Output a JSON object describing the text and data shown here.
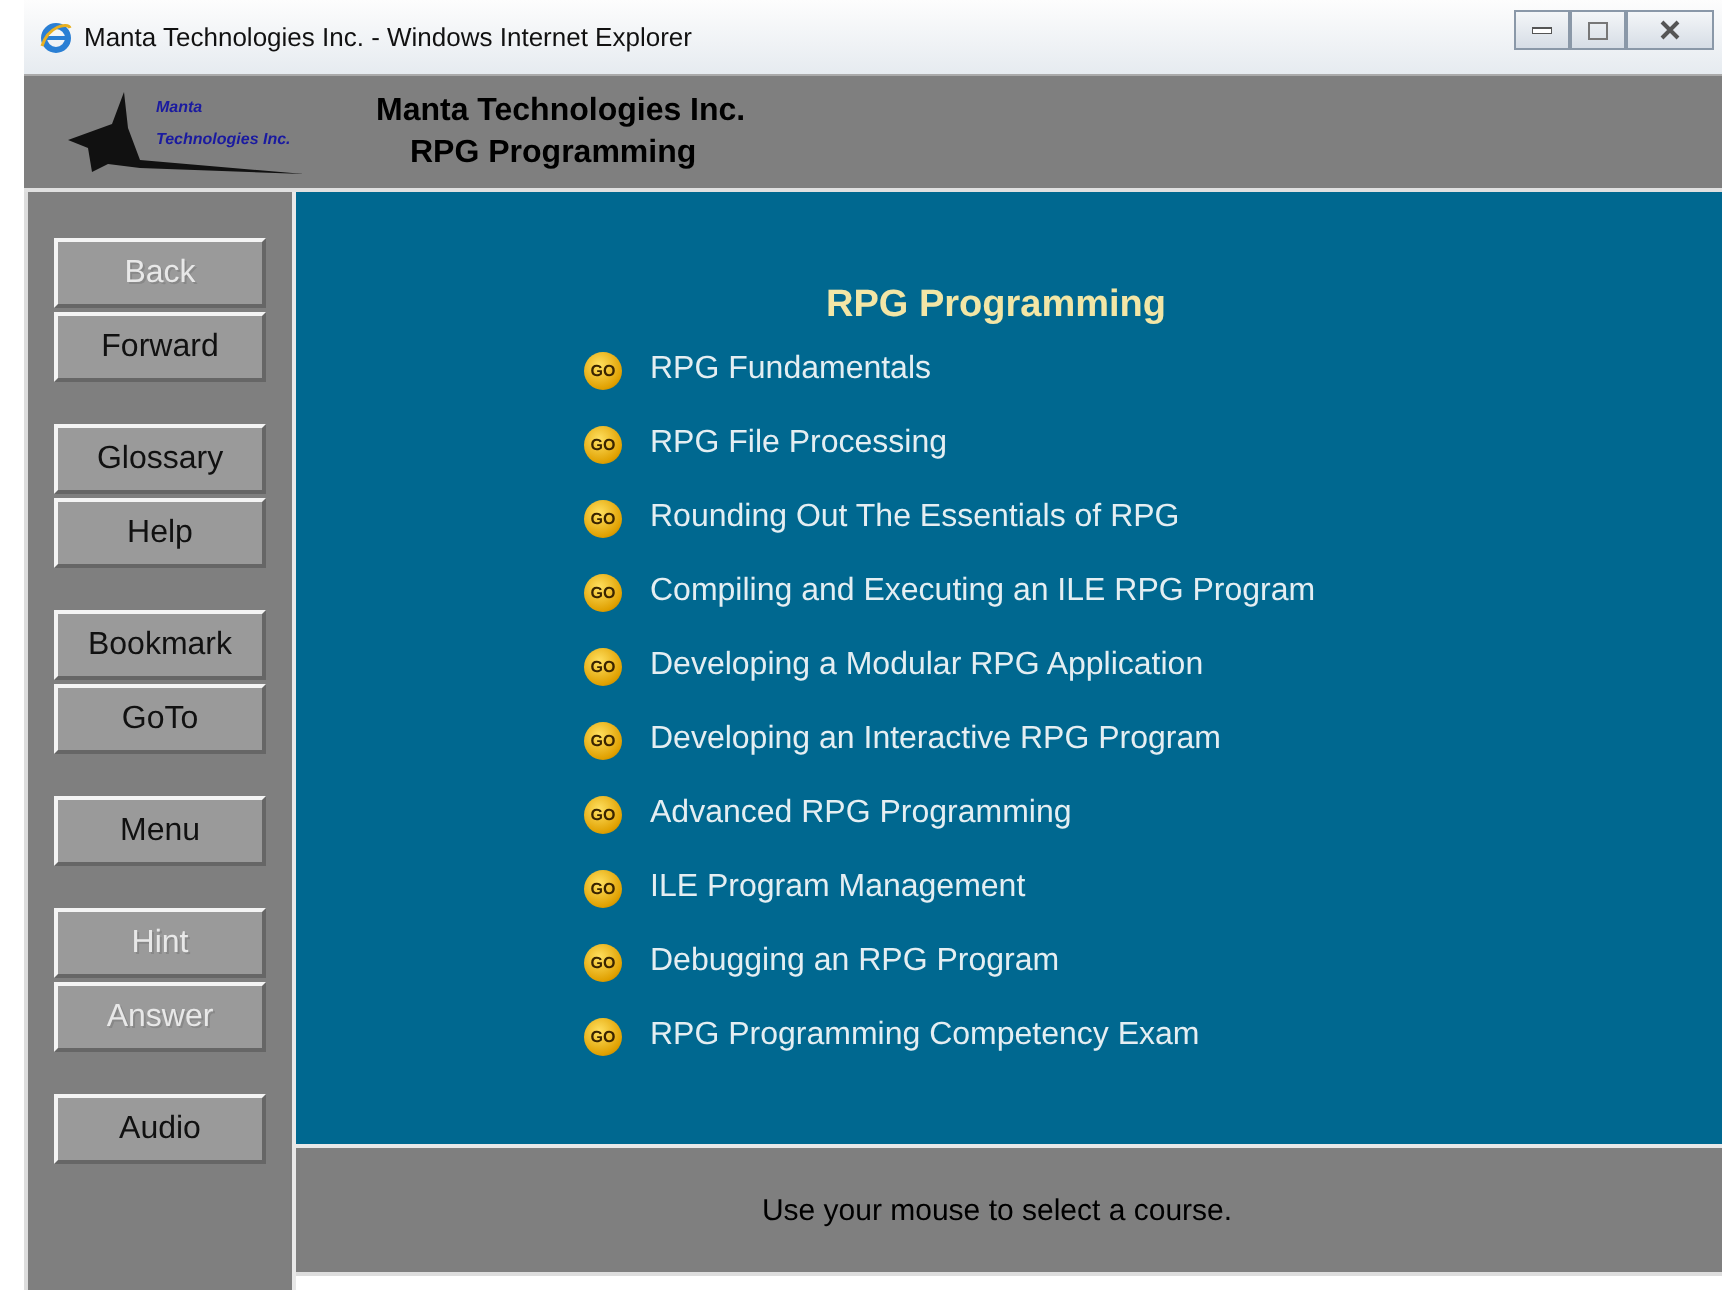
{
  "window": {
    "title": "Manta Technologies Inc. - Windows Internet Explorer"
  },
  "header": {
    "logo_lines": [
      "Manta",
      "Technologies Inc."
    ],
    "title_lines": [
      "Manta Technologies Inc.",
      "RPG Programming"
    ]
  },
  "sidebar": {
    "groups": [
      [
        {
          "label": "Back",
          "disabled": true
        },
        {
          "label": "Forward",
          "disabled": false
        }
      ],
      [
        {
          "label": "Glossary",
          "disabled": false
        },
        {
          "label": "Help",
          "disabled": false
        }
      ],
      [
        {
          "label": "Bookmark",
          "disabled": false
        },
        {
          "label": "GoTo",
          "disabled": false
        }
      ],
      [
        {
          "label": "Menu",
          "disabled": false
        }
      ],
      [
        {
          "label": "Hint",
          "disabled": true
        },
        {
          "label": "Answer",
          "disabled": true
        }
      ],
      [
        {
          "label": "Audio",
          "disabled": false
        }
      ]
    ]
  },
  "content": {
    "heading": "RPG Programming",
    "courses": [
      {
        "icon_label": "GO",
        "title": "RPG Fundamentals"
      },
      {
        "icon_label": "GO",
        "title": "RPG File Processing"
      },
      {
        "icon_label": "GO",
        "title": "Rounding Out The Essentials of RPG"
      },
      {
        "icon_label": "GO",
        "title": "Compiling and Executing an ILE RPG Program"
      },
      {
        "icon_label": "GO",
        "title": "Developing a Modular RPG Application"
      },
      {
        "icon_label": "GO",
        "title": "Developing an Interactive RPG Program"
      },
      {
        "icon_label": "GO",
        "title": "Advanced RPG Programming"
      },
      {
        "icon_label": "GO",
        "title": "ILE Program Management"
      },
      {
        "icon_label": "GO",
        "title": "Debugging an RPG Program"
      },
      {
        "icon_label": "GO",
        "title": "RPG Programming Competency Exam"
      }
    ]
  },
  "status_bar": {
    "message": "Use your mouse to select a course."
  }
}
